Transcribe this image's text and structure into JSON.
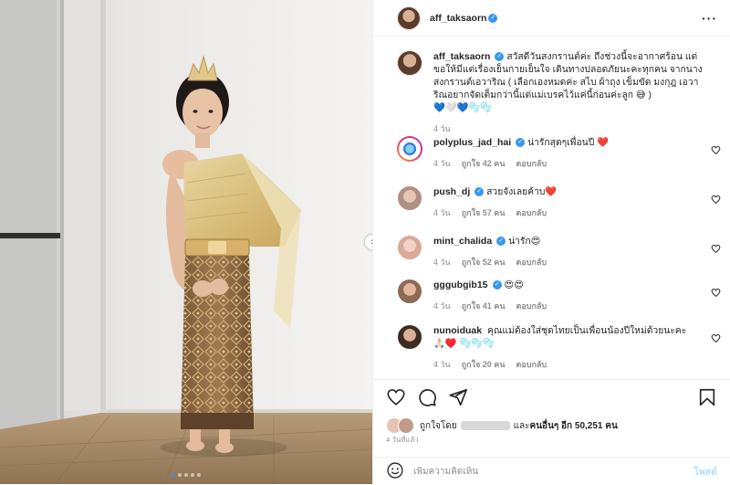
{
  "post": {
    "username": "aff_taksaorn",
    "more_icon": "more-horizontal-icon",
    "photo": {
      "carousel_total": 5,
      "carousel_active": 1,
      "next_icon": "chevron-right-icon"
    }
  },
  "caption": {
    "username": "aff_taksaorn",
    "text": "สวัสดีวันสงกรานต์ค่ะ ถึงช่วงนี้จะอากาศร้อน แต่ขอให้มีแต่เรื่องเย็นกายเย็นใจ เดินทางปลอดภัยนะคะทุกคน จากนางสงกรานต์เอวาริณ ( เลือกเองหมดค่ะ สไบ ผ้าถุง เข็มขัด มงกุฎ เอวาริณอยากจัดเต็มกว่านี้แต่แม่เบรคไว้แค่นี้ก่อนค่ะลูก 😅 )",
    "emoji_line": "💙🤍💙🫧🫧",
    "time": "4 วัน"
  },
  "comments": [
    {
      "username": "polyplus_jad_hai",
      "verified": true,
      "text": "น่ารักสุดๆเพื่อนปี ❤️",
      "time": "4 วัน",
      "likes": "ถูกใจ 42 คน",
      "reply": "ตอบกลับ"
    },
    {
      "username": "push_dj",
      "verified": true,
      "text": "สวยจังเลยค้าบ❤️",
      "time": "4 วัน",
      "likes": "ถูกใจ 57 คน",
      "reply": "ตอบกลับ"
    },
    {
      "username": "mint_chalida",
      "verified": true,
      "text": "น่ารัก😍",
      "time": "4 วัน",
      "likes": "ถูกใจ 52 คน",
      "reply": "ตอบกลับ"
    },
    {
      "username": "gggubgib15",
      "verified": true,
      "text": "😍😍",
      "time": "4 วัน",
      "likes": "ถูกใจ 41 คน",
      "reply": "ตอบกลับ"
    },
    {
      "username": "nunoiduak",
      "verified": false,
      "text": "คุณแม่ต้องใส่ชุดไทยเป็นเพื่อนน้องปีใหม่ด้วยนะคะ 🙏🏻♥️ 🫧🫧🫧",
      "time": "4 วัน",
      "likes": "ถูกใจ 20 คน",
      "reply": "ตอบกลับ"
    }
  ],
  "actions": {
    "like_icon": "heart-icon",
    "comment_icon": "comment-icon",
    "share_icon": "send-icon",
    "save_icon": "bookmark-icon",
    "liked_by_prefix": "ถูกใจโดย",
    "liked_by_suffix": "และ",
    "others_label": "คนอื่นๆ อีก 50,251 คน",
    "time_ago": "4 วันที่แล้ว"
  },
  "add_comment": {
    "emoji_icon": "smiley-icon",
    "placeholder": "เพิ่มความคิดเห็น",
    "post_label": "โพสต์"
  },
  "colors": {
    "verified": "#3897f0",
    "link": "#0095f6",
    "post_disabled": "#b2dffc",
    "heart_red": "#ed4956",
    "carousel_active": "#3a8ef6"
  }
}
